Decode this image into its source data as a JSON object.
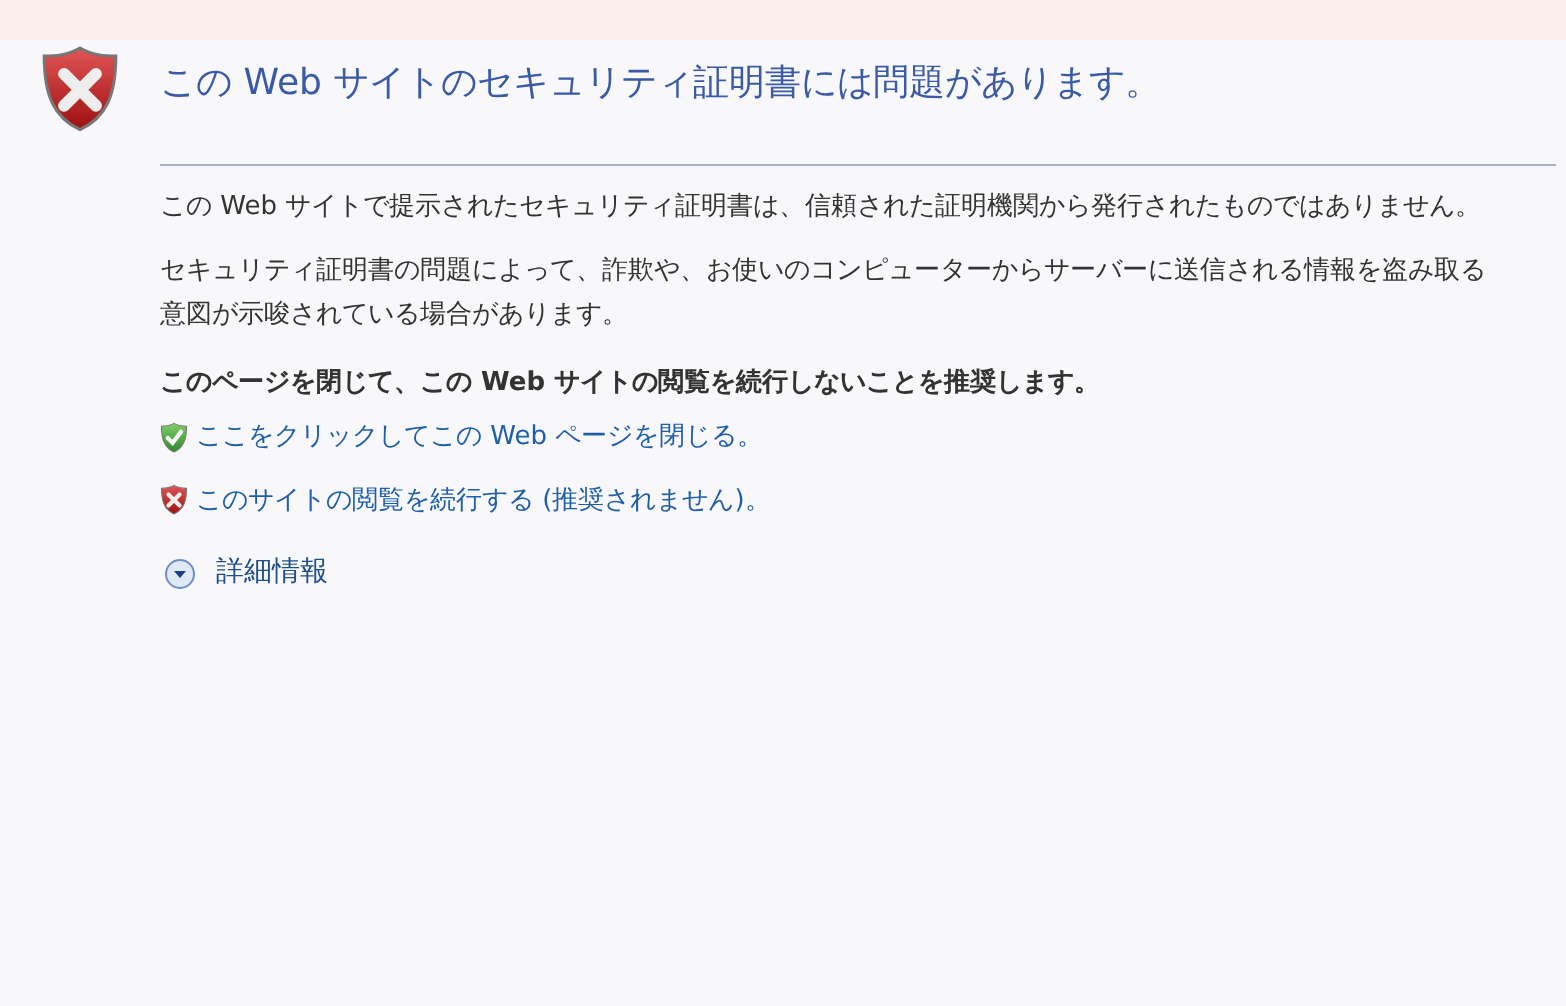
{
  "title": "この Web サイトのセキュリティ証明書には問題があります。",
  "paragraphs": [
    "この Web サイトで提示されたセキュリティ証明書は、信頼された証明機関から発行されたものではありません。",
    "セキュリティ証明書の問題によって、詐欺や、お使いのコンピューターからサーバーに送信される情報を盗み取る意図が示唆されている場合があります。"
  ],
  "recommendation": "このページを閉じて、この Web サイトの閲覧を続行しないことを推奨します。",
  "links": [
    {
      "kind": "safe",
      "label": "ここをクリックしてこの Web ページを閉じる。"
    },
    {
      "kind": "unsafe",
      "label": "このサイトの閲覧を続行する (推奨されません)。"
    }
  ],
  "more_info": {
    "label": "詳細情報",
    "expanded": false
  }
}
